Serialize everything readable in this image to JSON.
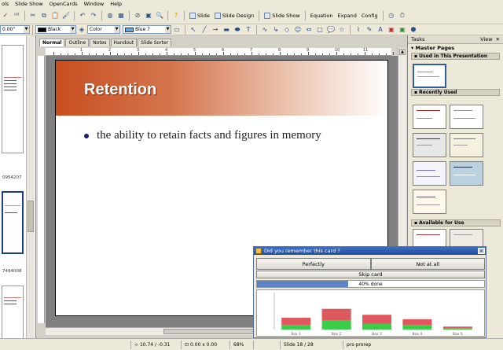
{
  "menu": [
    "ols",
    "Slide Show",
    "OpenCards",
    "Window",
    "Help"
  ],
  "toolbar1": {
    "slide_label": "Slide",
    "slide_design_label": "Slide Design",
    "slide_show_label": "Slide Show",
    "equation_label": "Equation",
    "expand_label": "Expand",
    "config_label": "Config"
  },
  "toolbar2": {
    "zoom_value": "0.00\"",
    "line_color": "Black",
    "fill_mode": "Color",
    "fill_color": "Blue 7"
  },
  "slide_panel": {
    "numbers": [
      "0954207",
      "7494008",
      "3261911"
    ]
  },
  "tabs": [
    "Normal",
    "Outline",
    "Notes",
    "Handout",
    "Slide Sorter"
  ],
  "ruler_numbers": [
    "1",
    "2",
    "3",
    "4",
    "5",
    "6",
    "7",
    "8",
    "9",
    "10",
    "11"
  ],
  "slide": {
    "title": "Retention",
    "bullet": "the ability to retain facts and figures in memory"
  },
  "tasks": {
    "header": "Tasks",
    "view": "View",
    "section": "Master Pages",
    "used_label": "Used in This Presentation",
    "recent_label": "Recently Used",
    "available_label": "Available for Use"
  },
  "dialog": {
    "title": "Did you remember this card ?",
    "perfectly": "Perfectly",
    "not_at_all": "Not at all",
    "skip": "Skip card",
    "progress_text": "40% done",
    "progress": 0.4
  },
  "chart_data": {
    "type": "bar",
    "categories": [
      "Box 1",
      "Box 2",
      "Box 3",
      "Box 4",
      "Box 5"
    ],
    "ylabel": "",
    "series": [
      {
        "values": [
          5,
          8,
          6,
          4,
          1
        ],
        "color": "#e0585f"
      },
      {
        "values": [
          3,
          6,
          4,
          3,
          1
        ],
        "color": "#3ccc4a"
      }
    ],
    "ylim": [
      0,
      25
    ]
  },
  "status": {
    "position": "10.74 / -0.31",
    "size": "0.00 x 0.00",
    "zoom": "68%",
    "slide": "Slide 18 / 28",
    "layout": "prs-prorep"
  },
  "colors": {
    "title_gradient_start": "#c74e1f",
    "progress_fill": "#5d83c6",
    "dialog_title": "#2b58ab"
  }
}
